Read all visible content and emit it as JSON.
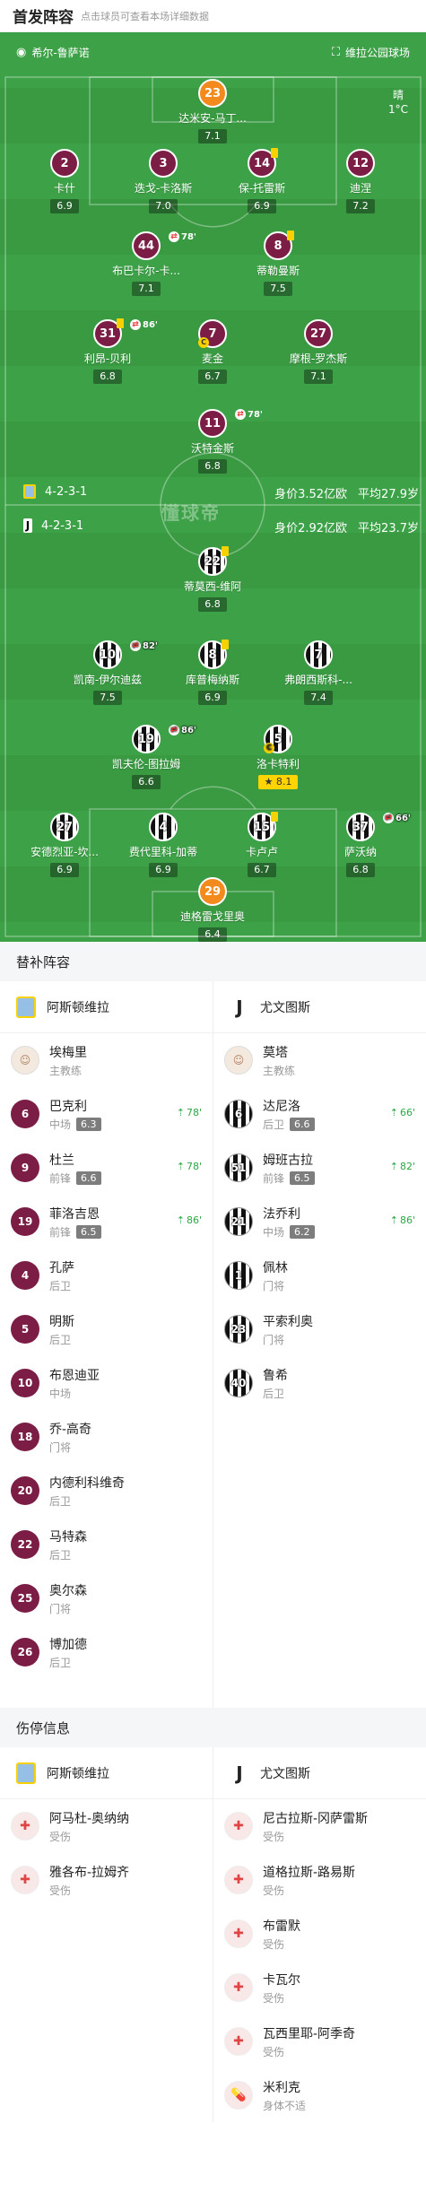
{
  "header": {
    "title": "首发阵容",
    "subtitle": "点击球员可查看本场详细数据"
  },
  "venue": {
    "referee": "希尔-鲁萨诺",
    "stadium": "维拉公园球场"
  },
  "weather": {
    "condition": "晴",
    "temp": "1°C"
  },
  "watermark": "懂球帝",
  "home_form": {
    "formation": "4-2-3-1",
    "value": "身价3.52亿欧",
    "age": "平均27.9岁"
  },
  "away_form": {
    "formation": "4-2-3-1",
    "value": "身价2.92亿欧",
    "age": "平均23.7岁"
  },
  "colors": {
    "pitch": "#3da147",
    "villa": "#7b1d45",
    "gk": "#f28a1e",
    "yellow": "#f8d200"
  },
  "home_players": [
    {
      "num": "23",
      "name": "达米安-马丁...",
      "rating": "7.1",
      "kit": "gk1"
    },
    {
      "num": "2",
      "name": "卡什",
      "rating": "6.9",
      "kit": "av"
    },
    {
      "num": "3",
      "name": "迭戈-卡洛斯",
      "rating": "7.0",
      "kit": "av"
    },
    {
      "num": "14",
      "name": "保-托雷斯",
      "rating": "6.9",
      "kit": "av",
      "yellow": true
    },
    {
      "num": "12",
      "name": "迪涅",
      "rating": "7.2",
      "kit": "av"
    },
    {
      "num": "44",
      "name": "布巴卡尔-卡...",
      "rating": "7.1",
      "kit": "av",
      "sub": "78'"
    },
    {
      "num": "8",
      "name": "蒂勒曼斯",
      "rating": "7.5",
      "kit": "av",
      "yellow": true
    },
    {
      "num": "31",
      "name": "利昂-贝利",
      "rating": "6.8",
      "kit": "av",
      "sub": "86'",
      "yellow": true
    },
    {
      "num": "7",
      "name": "麦金",
      "rating": "6.7",
      "kit": "av",
      "captain": "C"
    },
    {
      "num": "27",
      "name": "摩根-罗杰斯",
      "rating": "7.1",
      "kit": "av"
    },
    {
      "num": "11",
      "name": "沃特金斯",
      "rating": "6.8",
      "kit": "av",
      "sub": "78'"
    }
  ],
  "away_players": [
    {
      "num": "22",
      "name": "蒂莫西-维阿",
      "rating": "6.8",
      "kit": "ju",
      "yellow": true
    },
    {
      "num": "10",
      "name": "凯南-伊尔迪兹",
      "rating": "7.5",
      "kit": "ju",
      "sub": "82'"
    },
    {
      "num": "8",
      "name": "库普梅纳斯",
      "rating": "6.9",
      "kit": "ju",
      "yellow": true
    },
    {
      "num": "7",
      "name": "弗朗西斯科-...",
      "rating": "7.4",
      "kit": "ju"
    },
    {
      "num": "19",
      "name": "凯夫伦-图拉姆",
      "rating": "6.6",
      "kit": "ju",
      "sub": "86'"
    },
    {
      "num": "5",
      "name": "洛卡特利",
      "rating": "8.1",
      "kit": "ju",
      "captain": "C",
      "star": true
    },
    {
      "num": "27",
      "name": "安德烈亚-坎...",
      "rating": "6.9",
      "kit": "ju"
    },
    {
      "num": "4",
      "name": "费代里科-加蒂",
      "rating": "6.9",
      "kit": "ju"
    },
    {
      "num": "15",
      "name": "卡卢卢",
      "rating": "6.7",
      "kit": "ju",
      "yellow": true
    },
    {
      "num": "37",
      "name": "萨沃纳",
      "rating": "6.8",
      "kit": "ju",
      "sub": "66'"
    },
    {
      "num": "29",
      "name": "迪格雷戈里奥",
      "rating": "6.4",
      "kit": "gk2"
    }
  ],
  "subs_section": {
    "title": "替补阵容"
  },
  "teams": {
    "home": "阿斯顿维拉",
    "away": "尤文图斯"
  },
  "home_subs": [
    {
      "num": "",
      "name": "埃梅里",
      "role": "主教练",
      "coach": true
    },
    {
      "num": "6",
      "name": "巴克利",
      "role": "中场",
      "rating": "6.3",
      "time": "78'"
    },
    {
      "num": "9",
      "name": "杜兰",
      "role": "前锋",
      "rating": "6.6",
      "time": "78'"
    },
    {
      "num": "19",
      "name": "菲洛吉恩",
      "role": "前锋",
      "rating": "6.5",
      "time": "86'"
    },
    {
      "num": "4",
      "name": "孔萨",
      "role": "后卫"
    },
    {
      "num": "5",
      "name": "明斯",
      "role": "后卫"
    },
    {
      "num": "10",
      "name": "布恩迪亚",
      "role": "中场"
    },
    {
      "num": "18",
      "name": "乔-高奇",
      "role": "门将"
    },
    {
      "num": "20",
      "name": "内德利科维奇",
      "role": "后卫"
    },
    {
      "num": "22",
      "name": "马特森",
      "role": "后卫"
    },
    {
      "num": "25",
      "name": "奥尔森",
      "role": "门将"
    },
    {
      "num": "26",
      "name": "博加德",
      "role": "后卫"
    }
  ],
  "away_subs": [
    {
      "num": "",
      "name": "莫塔",
      "role": "主教练",
      "coach": true
    },
    {
      "num": "6",
      "name": "达尼洛",
      "role": "后卫",
      "rating": "6.6",
      "time": "66'"
    },
    {
      "num": "51",
      "name": "姆班古拉",
      "role": "前锋",
      "rating": "6.5",
      "time": "82'"
    },
    {
      "num": "21",
      "name": "法乔利",
      "role": "中场",
      "rating": "6.2",
      "time": "86'"
    },
    {
      "num": "1",
      "name": "佩林",
      "role": "门将"
    },
    {
      "num": "23",
      "name": "平索利奥",
      "role": "门将"
    },
    {
      "num": "40",
      "name": "鲁希",
      "role": "后卫"
    }
  ],
  "injury_section": {
    "title": "伤停信息"
  },
  "home_injuries": [
    {
      "name": "阿马杜-奥纳纳",
      "reason": "受伤",
      "icon": "injury"
    },
    {
      "name": "雅各布-拉姆齐",
      "reason": "受伤",
      "icon": "injury"
    }
  ],
  "away_injuries": [
    {
      "name": "尼古拉斯-冈萨雷斯",
      "reason": "受伤",
      "icon": "injury"
    },
    {
      "name": "道格拉斯-路易斯",
      "reason": "受伤",
      "icon": "injury"
    },
    {
      "name": "布雷默",
      "reason": "受伤",
      "icon": "injury"
    },
    {
      "name": "卡瓦尔",
      "reason": "受伤",
      "icon": "injury"
    },
    {
      "name": "瓦西里耶-阿季奇",
      "reason": "受伤",
      "icon": "injury"
    },
    {
      "name": "米利克",
      "reason": "身体不适",
      "icon": "pill"
    }
  ]
}
